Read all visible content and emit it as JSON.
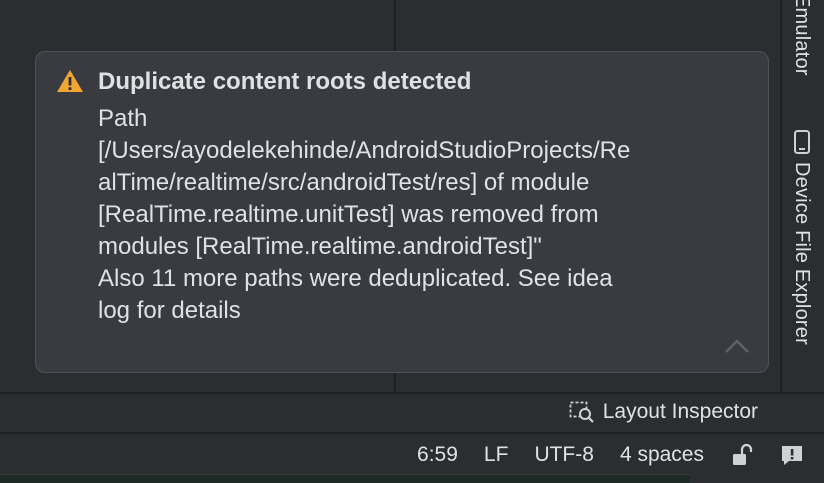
{
  "right_strip": {
    "emulator_label": "Emulator",
    "device_file_explorer_label": "Device File Explorer"
  },
  "notification": {
    "title": "Duplicate content roots detected",
    "body_lines": [
      "Path",
      "[/Users/ayodelekehinde/AndroidStudioProjects/Re",
      "alTime/realtime/src/androidTest/res] of module",
      "[RealTime.realtime.unitTest] was removed from",
      "modules [RealTime.realtime.androidTest]\"",
      "Also 11 more paths were deduplicated. See idea",
      "log for details"
    ],
    "icon": "warning-icon",
    "warning_color": "#f0a732"
  },
  "toolbar": {
    "layout_inspector_label": "Layout Inspector"
  },
  "status_bar": {
    "cursor_position": "6:59",
    "line_separator": "LF",
    "encoding": "UTF-8",
    "indent": "4 spaces"
  }
}
